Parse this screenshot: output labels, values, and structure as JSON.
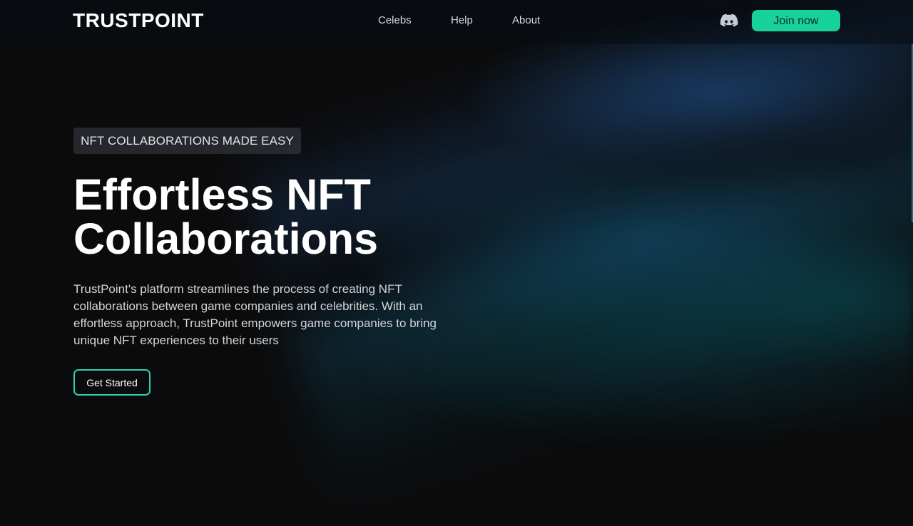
{
  "header": {
    "logo": "TRUSTPOINT",
    "nav": [
      {
        "label": "Celebs"
      },
      {
        "label": "Help"
      },
      {
        "label": "About"
      }
    ],
    "discord_icon": "discord-icon",
    "join_label": "Join now"
  },
  "hero": {
    "badge": "NFT COLLABORATIONS MADE EASY",
    "title_line1": "Effortless NFT",
    "title_line2": "Collaborations",
    "description": "TrustPoint's platform streamlines the process of creating NFT collaborations between game companies and celebrities. With an effortless approach, TrustPoint empowers game companies to bring unique NFT experiences to their users",
    "cta_label": "Get Started"
  },
  "colors": {
    "background": "#0b0b0c",
    "accent": "#17d39a",
    "cta_border": "#2fd0b0"
  }
}
